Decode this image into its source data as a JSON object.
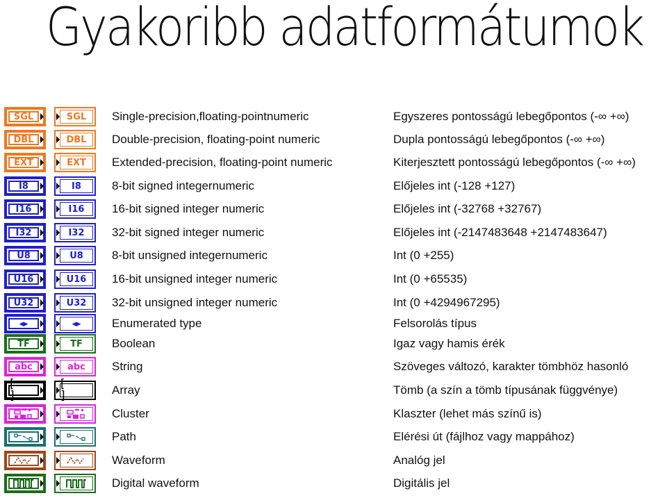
{
  "title": "Gyakoribb adatformátumok",
  "rows": [
    {
      "icon": "sgl-terminal-icon",
      "label": "SGL",
      "color": "#f07820",
      "en": "Single-precision,floating-pointnumeric",
      "hu": "Egyszeres pontosságú lebegőpontos (-∞ +∞)"
    },
    {
      "icon": "dbl-terminal-icon",
      "label": "DBL",
      "color": "#f07820",
      "en": "Double-precision, floating-point numeric",
      "hu": "Dupla pontosságú lebegőpontos (-∞ +∞)"
    },
    {
      "icon": "ext-terminal-icon",
      "label": "EXT",
      "color": "#f07820",
      "en": "Extended-precision, floating-point numeric",
      "hu": "Kiterjesztett pontosságú lebegőpontos (-∞ +∞)"
    },
    {
      "icon": "i8-terminal-icon",
      "label": "I8",
      "color": "#1f1fd0",
      "en": "8-bit signed integernumeric",
      "hu": "Előjeles int (-128 +127)"
    },
    {
      "icon": "i16-terminal-icon",
      "label": "I16",
      "color": "#1f1fd0",
      "en": "16-bit signed integer numeric",
      "hu": "Előjeles int (-32768 +32767)"
    },
    {
      "icon": "i32-terminal-icon",
      "label": "I32",
      "color": "#1f1fd0",
      "en": "32-bit signed integer numeric",
      "hu": "Előjeles int (-2147483648 +2147483647)"
    },
    {
      "icon": "u8-terminal-icon",
      "label": "U8",
      "color": "#1f1fd0",
      "en": "8-bit unsigned integernumeric",
      "hu": "Int (0 +255)"
    },
    {
      "icon": "u16-terminal-icon",
      "label": "U16",
      "color": "#1f1fd0",
      "en": "16-bit unsigned integer numeric",
      "hu": "Int (0 +65535)"
    },
    {
      "icon": "u32-terminal-icon",
      "label": "U32",
      "color": "#1f1fd0",
      "en": "32-bit unsigned integer numeric",
      "hu": "Int (0 +4294967295)"
    },
    {
      "icon": "enum-terminal-icon",
      "label": "◂▸",
      "color": "#1f1fd0",
      "en": "Enumerated type",
      "hu": "Felsorolás típus"
    },
    {
      "icon": "boolean-terminal-icon",
      "label": "TF",
      "color": "#1a6e1a",
      "en": "Boolean",
      "hu": "Igaz vagy hamis érék"
    },
    {
      "icon": "string-terminal-icon",
      "label": "abc",
      "color": "#e020e0",
      "en": "String",
      "hu": "Szöveges változó, karakter tömbhöz hasonló"
    },
    {
      "icon": "array-terminal-icon",
      "label": "[ ]",
      "color": "#000000",
      "en": "Array",
      "hu": "Tömb (a szín a tömb típusának függvénye)"
    },
    {
      "icon": "cluster-terminal-icon",
      "label": "",
      "color": "#e020e0",
      "en": "Cluster",
      "hu": "Klaszter (lehet más színű is)"
    },
    {
      "icon": "path-terminal-icon",
      "label": "",
      "color": "#1a7070",
      "en": "Path",
      "hu": "Elérési út (fájlhoz vagy mappához)"
    },
    {
      "icon": "waveform-terminal-icon",
      "label": "",
      "color": "#a0461a",
      "en": "Waveform",
      "hu": "Analóg jel"
    },
    {
      "icon": "digital-waveform-terminal-icon",
      "label": "",
      "color": "#1a6e1a",
      "en": "Digital waveform",
      "hu": "Digitális jel"
    }
  ]
}
